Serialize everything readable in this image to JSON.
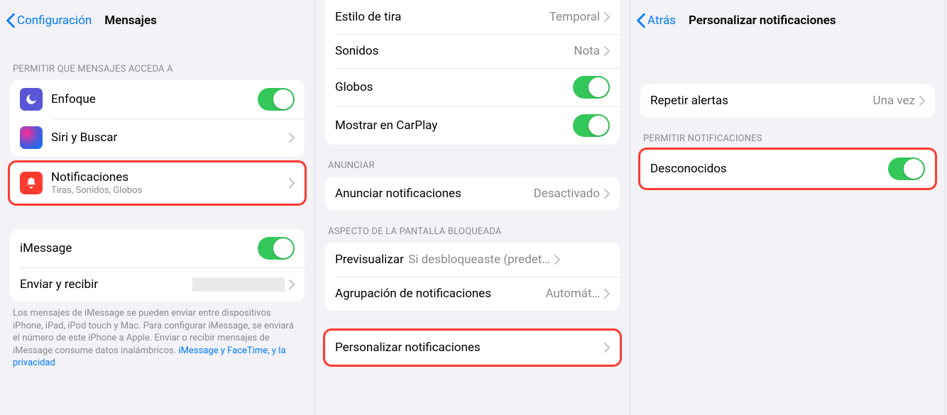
{
  "panel1": {
    "back_label": "Configuración",
    "title": "Mensajes",
    "section1_header": "PERMITIR QUE MENSAJES ACCEDA A",
    "enfoque_label": "Enfoque",
    "siri_label": "Siri y Buscar",
    "notif_label": "Notificaciones",
    "notif_sub": "Tiras, Sonidos, Globos",
    "imessage_label": "iMessage",
    "sendreceive_label": "Enviar y recibir",
    "footer_text": "Los mensajes de iMessage se pueden enviar entre dispositivos iPhone, iPad, iPod touch y Mac. Para configurar iMessage, se enviará el número de este iPhone a Apple. Enviar o recibir mensajes de iMessage consume datos inalámbricos. ",
    "footer_link": "iMessage y FaceTime, y la privacidad"
  },
  "panel2": {
    "banner_style_label": "Estilo de tira",
    "banner_style_value": "Temporal",
    "sounds_label": "Sonidos",
    "sounds_value": "Nota",
    "badges_label": "Globos",
    "carplay_label": "Mostrar en CarPlay",
    "announce_header": "ANUNCIAR",
    "announce_label": "Anunciar notificaciones",
    "announce_value": "Desactivado",
    "lockscreen_header": "ASPECTO DE LA PANTALLA BLOQUEADA",
    "preview_label": "Previsualizar",
    "preview_value": "Si desbloqueaste (predet…",
    "grouping_label": "Agrupación de notificaciones",
    "grouping_value": "Automát…",
    "customize_label": "Personalizar notificaciones"
  },
  "panel3": {
    "back_label": "Atrás",
    "title": "Personalizar notificaciones",
    "repeat_label": "Repetir alertas",
    "repeat_value": "Una vez",
    "allow_header": "PERMITIR NOTIFICACIONES",
    "unknown_label": "Desconocidos"
  }
}
